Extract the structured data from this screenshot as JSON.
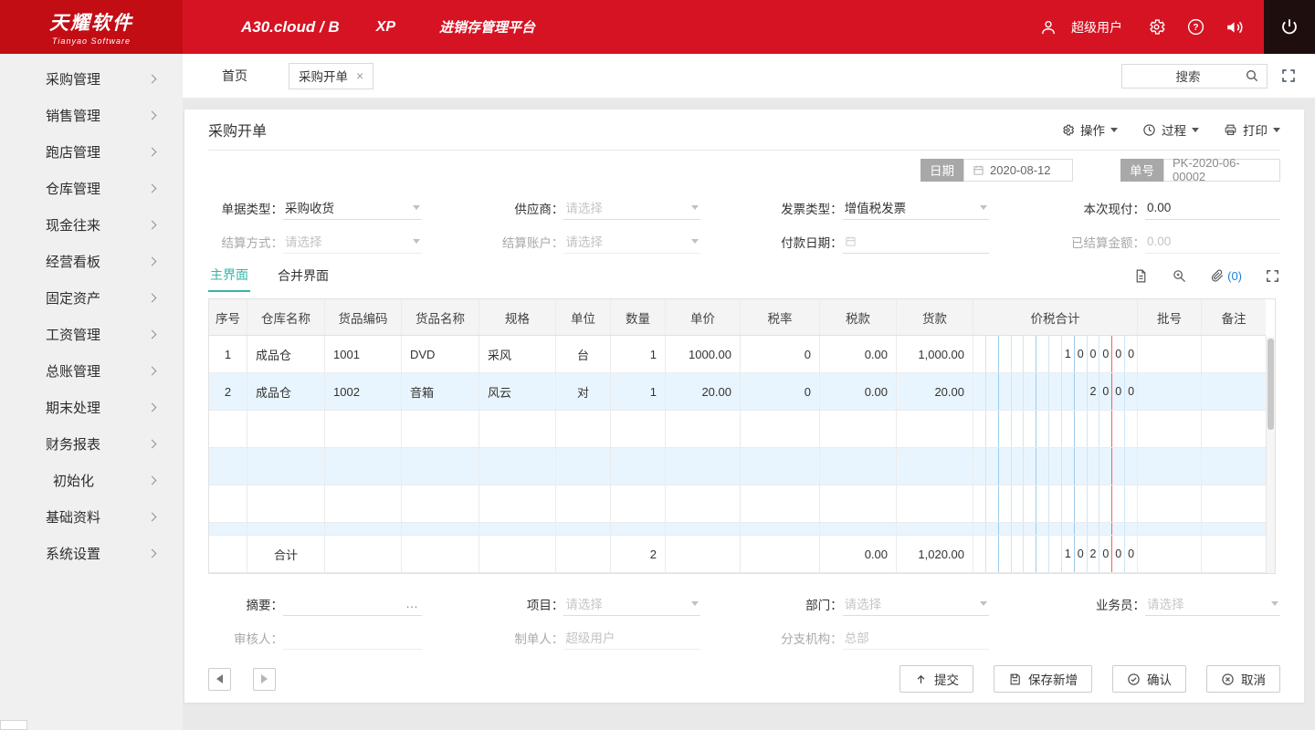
{
  "header": {
    "logo_title": "天耀软件",
    "logo_subtitle": "Tianyao Software",
    "app_title": "A30.cloud / B",
    "app_edition": "XP",
    "platform_name": "进销存管理平台",
    "user_name": "超级用户"
  },
  "sidebar": {
    "items": [
      {
        "label": "采购管理"
      },
      {
        "label": "销售管理"
      },
      {
        "label": "跑店管理"
      },
      {
        "label": "仓库管理"
      },
      {
        "label": "现金往来"
      },
      {
        "label": "经营看板"
      },
      {
        "label": "固定资产"
      },
      {
        "label": "工资管理"
      },
      {
        "label": "总账管理"
      },
      {
        "label": "期末处理"
      },
      {
        "label": "财务报表"
      },
      {
        "label": "初始化",
        "indent": true
      },
      {
        "label": "基础资料"
      },
      {
        "label": "系统设置"
      }
    ]
  },
  "tabbar": {
    "home_tab": "首页",
    "active_tab": "采购开单",
    "search_placeholder": "搜索"
  },
  "page": {
    "title": "采购开单",
    "operate_label": "操作",
    "process_label": "过程",
    "print_label": "打印",
    "date_label": "日期",
    "date_value": "2020-08-12",
    "number_label": "单号",
    "number_value": "PK-2020-06-00002"
  },
  "form": {
    "doc_type_label": "单据类型：",
    "doc_type_value": "采购收货",
    "supplier_label": "供应商：",
    "supplier_placeholder": "请选择",
    "invoice_type_label": "发票类型：",
    "invoice_type_value": "增值税发票",
    "cash_paid_label": "本次现付：",
    "cash_paid_value": "0.00",
    "settle_method_label": "结算方式：",
    "settle_method_placeholder": "请选择",
    "settle_account_label": "结算账户：",
    "settle_account_placeholder": "请选择",
    "pay_date_label": "付款日期：",
    "settled_amount_label": "已结算金额：",
    "settled_amount_value": "0.00"
  },
  "detail_tabs": {
    "main_label": "主界面",
    "merge_label": "合并界面",
    "attachment_count": "(0)"
  },
  "table": {
    "headers": [
      "序号",
      "仓库名称",
      "货品编码",
      "货品名称",
      "规格",
      "单位",
      "数量",
      "单价",
      "税率",
      "税款",
      "货款",
      "价税合计",
      "批号",
      "备注"
    ],
    "rows": [
      [
        "1",
        "成品仓",
        "1001",
        "DVD",
        "采风",
        "台",
        "1",
        "1000.00",
        "0",
        "0.00",
        "1,000.00",
        "100000",
        "",
        ""
      ],
      [
        "2",
        "成品仓",
        "1002",
        "音箱",
        "风云",
        "对",
        "1",
        "20.00",
        "0",
        "0.00",
        "20.00",
        "2000",
        "",
        ""
      ]
    ],
    "empty_row_count": 3,
    "total_row": {
      "label": "合计",
      "qty": "2",
      "tax": "0.00",
      "amount": "1,020.00",
      "digits": "102000"
    }
  },
  "footer_form": {
    "summary_label": "摘要：",
    "project_label": "项目：",
    "project_placeholder": "请选择",
    "department_label": "部门：",
    "department_placeholder": "请选择",
    "salesman_label": "业务员：",
    "salesman_placeholder": "请选择",
    "auditor_label": "审核人：",
    "maker_label": "制单人：",
    "maker_value": "超级用户",
    "branch_label": "分支机构：",
    "branch_value": "总部"
  },
  "buttons": {
    "submit": "提交",
    "save_new": "保存新增",
    "confirm": "确认",
    "cancel": "取消"
  }
}
